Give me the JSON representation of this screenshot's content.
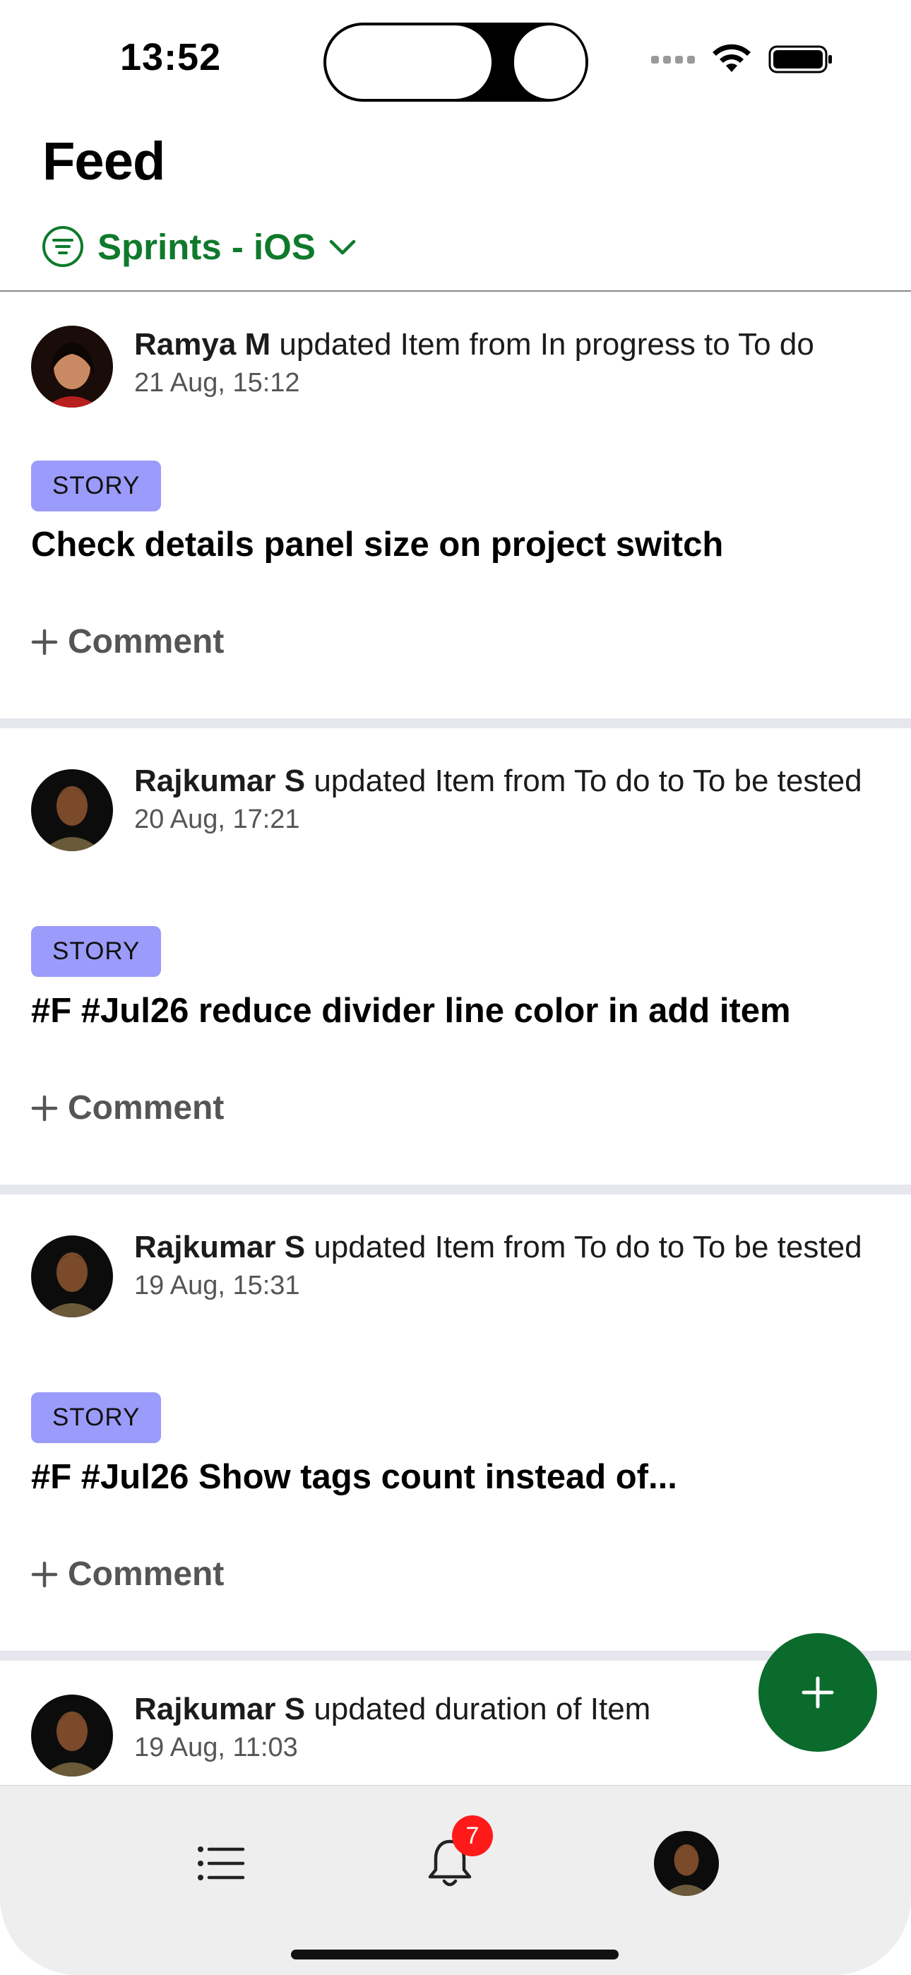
{
  "status_bar": {
    "time": "13:52"
  },
  "header": {
    "title": "Feed",
    "filter_label": "Sprints - iOS"
  },
  "feed": [
    {
      "user": "Ramya M",
      "action": " updated Item from In progress to To do",
      "time": "21 Aug, 15:12",
      "type": "STORY",
      "title": "Check details panel size on project switch",
      "comment_label": "Comment"
    },
    {
      "user": "Rajkumar S",
      "action": " updated Item from To do to To be tested",
      "time": "20 Aug, 17:21",
      "type": "STORY",
      "title": "#F #Jul26 reduce divider line color in add item",
      "comment_label": "Comment"
    },
    {
      "user": "Rajkumar S",
      "action": " updated Item from To do to To be tested",
      "time": "19 Aug, 15:31",
      "type": "STORY",
      "title": "#F #Jul26 Show tags count instead of...",
      "comment_label": "Comment"
    },
    {
      "user": "Rajkumar S",
      "action": " updated duration of Item",
      "time": "19 Aug, 11:03"
    }
  ],
  "tab_bar": {
    "notification_count": "7"
  },
  "colors": {
    "accent_green": "#0f7a2c",
    "fab_green": "#0b6b2c",
    "story_badge": "#9b9bfb",
    "notification_red": "#ff1a1a"
  },
  "icons": [
    "filter-icon",
    "chevron-down-icon",
    "plus-icon",
    "list-icon",
    "bell-icon",
    "profile-avatar"
  ]
}
